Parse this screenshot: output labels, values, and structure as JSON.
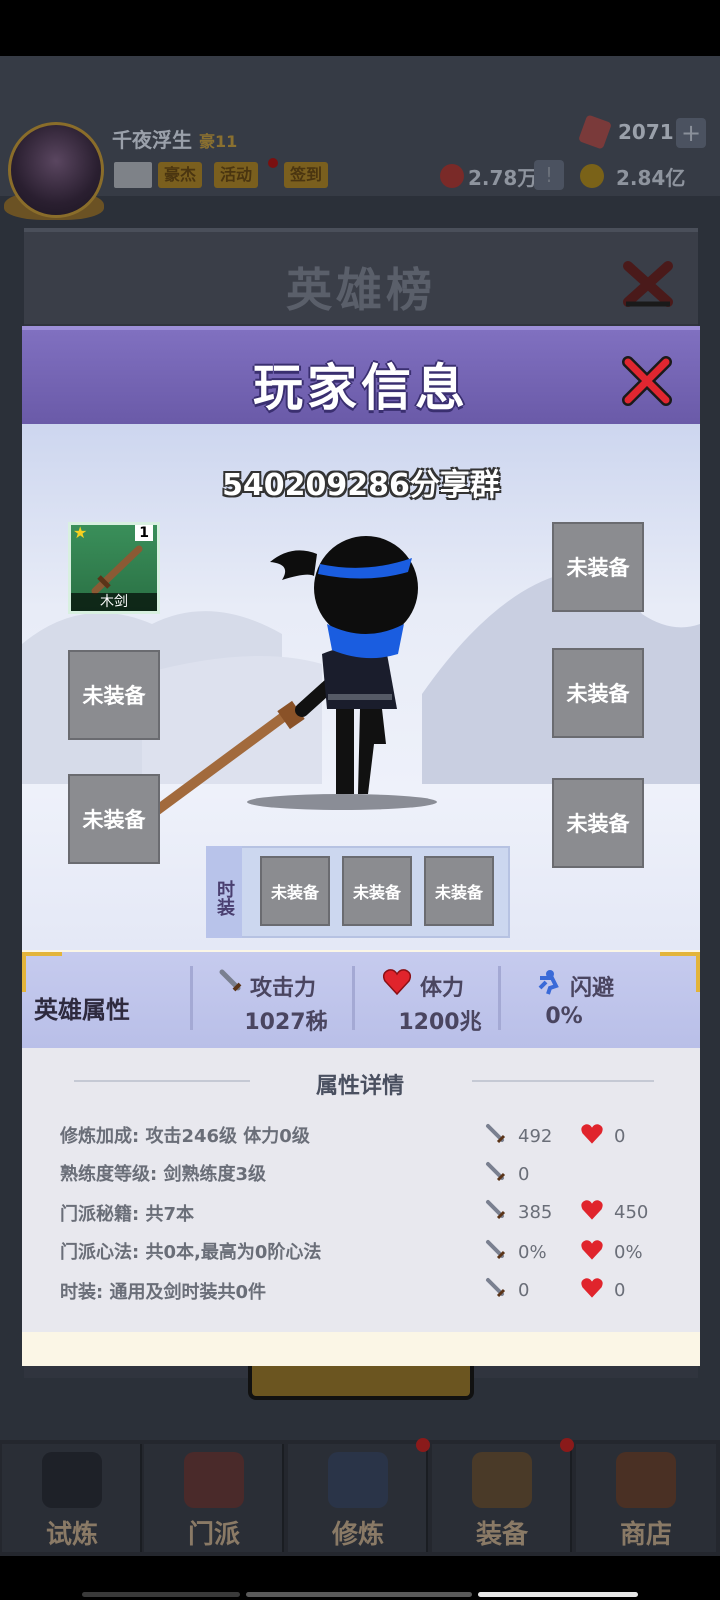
{
  "top_bar": {
    "player_name": "千夜浮生",
    "player_level": "11",
    "buttons": [
      "豪杰",
      "活动",
      "签到"
    ],
    "gems": "2071",
    "resource_a": "2.78万",
    "gold": "2.84亿",
    "plus_glyph": "+",
    "alert_glyph": "!"
  },
  "back_panel": {
    "title": "英雄榜"
  },
  "dialog": {
    "title": "玩家信息",
    "player_id": "540209286分享群",
    "weapon_slot": {
      "name": "木剑",
      "level": "1"
    },
    "empty_slot_label": "未装备",
    "fashion_label": "时装",
    "fashion_slots": [
      "未装备",
      "未装备",
      "未装备"
    ]
  },
  "stats": {
    "section_title": "英雄属性",
    "attack": {
      "label": "攻击力",
      "value": "1027秭"
    },
    "stamina": {
      "label": "体力",
      "value": "1200兆"
    },
    "dodge": {
      "label": "闪避",
      "value": "0%"
    }
  },
  "details": {
    "title": "属性详情",
    "rows": [
      {
        "label": "修炼加成:  攻击246级 体力0级",
        "atk": "492",
        "hp": "0"
      },
      {
        "label": "熟练度等级:  剑熟练度3级",
        "atk": "0",
        "hp": ""
      },
      {
        "label": "门派秘籍:  共7本",
        "atk": "385",
        "hp": "450"
      },
      {
        "label": "门派心法:  共0本,最高为0阶心法",
        "atk": "0%",
        "hp": "0%"
      },
      {
        "label": "时装:  通用及剑时装共0件",
        "atk": "0",
        "hp": "0"
      }
    ]
  },
  "bottom_nav": [
    {
      "label": "试炼"
    },
    {
      "label": "门派"
    },
    {
      "label": "修炼"
    },
    {
      "label": "装备"
    },
    {
      "label": "商店"
    }
  ],
  "colors": {
    "dialog_header": "#6a5aa8",
    "stats_band": "#b9bfe8",
    "empty_slot": "#8b8c90",
    "weapon_slot": "#2a7044",
    "heart": "#e0242c",
    "gold_accent": "#e3b43a"
  }
}
